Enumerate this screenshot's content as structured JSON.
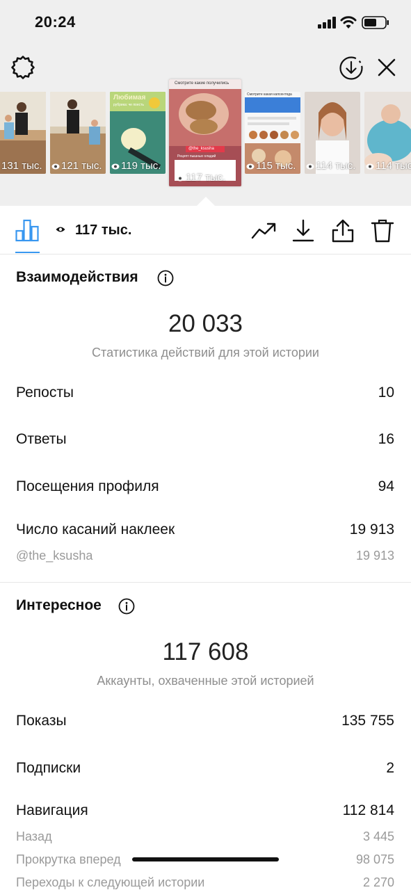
{
  "status_bar": {
    "time": "20:24"
  },
  "stories": [
    {
      "views": "131 тыс."
    },
    {
      "views": "121 тыс."
    },
    {
      "views": "119 тыс."
    },
    {
      "views": "117 тыс."
    },
    {
      "views": "115 тыс."
    },
    {
      "views": "114 тыс."
    },
    {
      "views": "114 тыс."
    }
  ],
  "story_texts": {
    "s3_title": "Любимая",
    "s3_sub": "рубрика: че поесть",
    "s4_top": "Смотрите какие получились",
    "s4_mention": "@the_ksusha",
    "s4_bottom1": "Рецепт пышных оладий",
    "s4_bottom2": "Рецепт пышных оладий",
    "s5_top": "Смотрите какая капсентяда"
  },
  "action_bar": {
    "views": "117 тыс."
  },
  "interactions": {
    "title": "Взаимодействия",
    "total": "20 033",
    "caption": "Статистика действий для этой истории",
    "rows": [
      {
        "label": "Репосты",
        "value": "10"
      },
      {
        "label": "Ответы",
        "value": "16"
      },
      {
        "label": "Посещения профиля",
        "value": "94"
      },
      {
        "label": "Число касаний наклеек",
        "value": "19 913"
      }
    ],
    "sub_rows": [
      {
        "label": "@the_ksusha",
        "value": "19 913"
      }
    ]
  },
  "discovery": {
    "title": "Интересное",
    "total": "117 608",
    "caption": "Аккаунты, охваченные этой историей",
    "rows": [
      {
        "label": "Показы",
        "value": "135 755"
      },
      {
        "label": "Подписки",
        "value": "2"
      },
      {
        "label": "Навигация",
        "value": "112 814"
      }
    ],
    "sub_rows": [
      {
        "label": "Назад",
        "value": "3 445"
      },
      {
        "label": "Прокрутка вперед",
        "value": "98 075"
      },
      {
        "label": "Переходы к следующей истории",
        "value": "2 270"
      }
    ]
  },
  "colors": {
    "accent": "#3897f0",
    "secondary_text": "#8e8e8e",
    "top_background": "#efefef"
  }
}
